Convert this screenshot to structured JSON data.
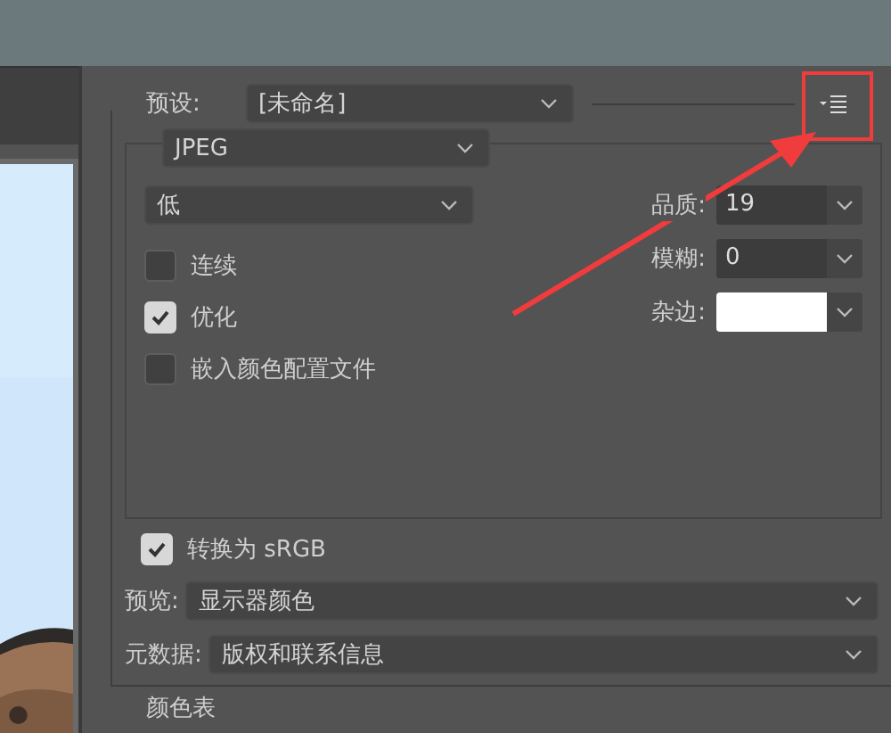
{
  "preset": {
    "label": "预设:",
    "value": "[未命名]"
  },
  "format": "JPEG",
  "quality_preset": "低",
  "options": [
    {
      "label": "连续",
      "checked": false
    },
    {
      "label": "优化",
      "checked": true
    },
    {
      "label": "嵌入颜色配置文件",
      "checked": false
    }
  ],
  "settings": [
    {
      "kind": "select",
      "label": "品质:",
      "value": "19"
    },
    {
      "kind": "select",
      "label": "模糊:",
      "value": "0"
    },
    {
      "kind": "swatch",
      "label": "杂边:",
      "color": "#ffffff"
    }
  ],
  "convert_srgb": {
    "label": "转换为 sRGB",
    "checked": true
  },
  "preview": {
    "label": "预览:",
    "value": "显示器颜色"
  },
  "metadata": {
    "label": "元数据:",
    "value": "版权和联系信息"
  },
  "color_table": {
    "label": "颜色表"
  }
}
